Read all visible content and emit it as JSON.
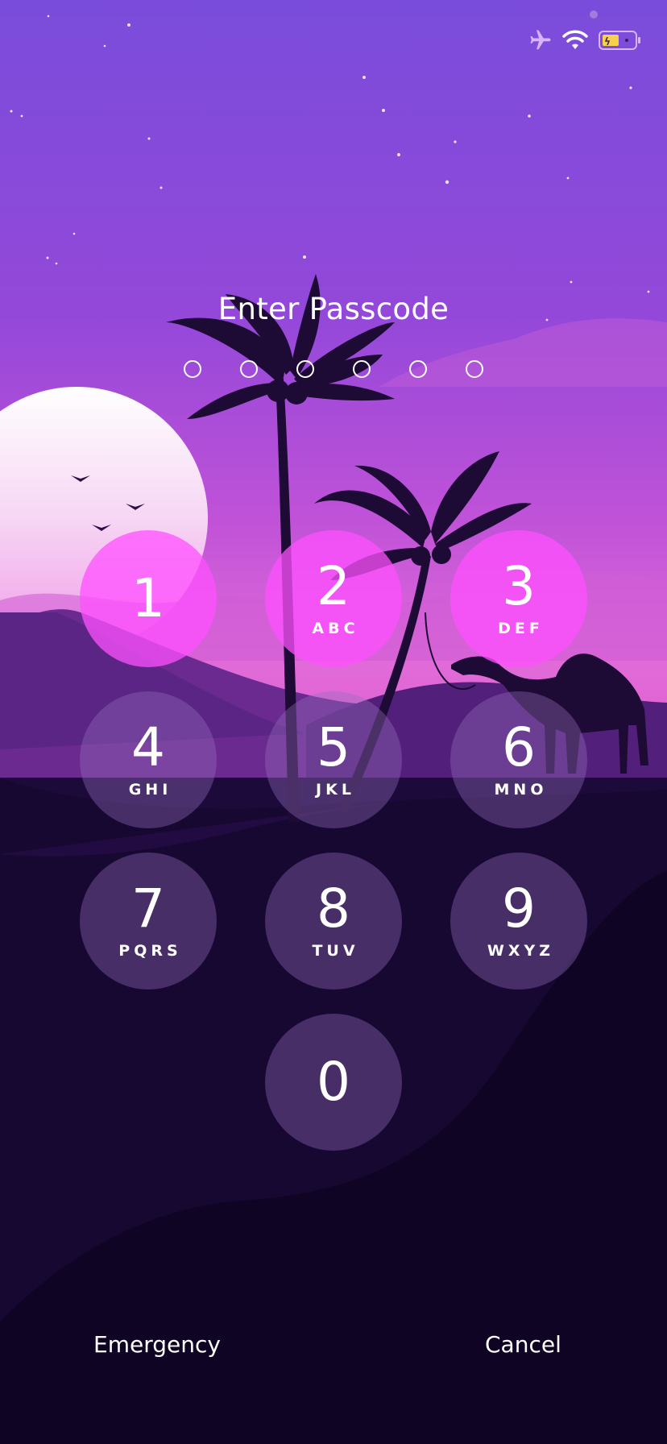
{
  "status_bar": {
    "icons": [
      "airplane-mode-icon",
      "wifi-icon",
      "battery-low-power-icon"
    ],
    "colors": {
      "icon": "#d9b3ff",
      "battery_fill": "#f6d24a"
    }
  },
  "lock_screen": {
    "title": "Enter Passcode",
    "passcode_length": 6,
    "filled_digits": 0
  },
  "keypad": [
    {
      "number": "1",
      "letters": ""
    },
    {
      "number": "2",
      "letters": "ABC"
    },
    {
      "number": "3",
      "letters": "DEF"
    },
    {
      "number": "4",
      "letters": "GHI"
    },
    {
      "number": "5",
      "letters": "JKL"
    },
    {
      "number": "6",
      "letters": "MNO"
    },
    {
      "number": "7",
      "letters": "PQRS"
    },
    {
      "number": "8",
      "letters": "TUV"
    },
    {
      "number": "9",
      "letters": "WXYZ"
    },
    {
      "number": "0",
      "letters": ""
    }
  ],
  "footer": {
    "emergency_label": "Emergency",
    "cancel_label": "Cancel"
  },
  "wallpaper": {
    "subject": "desert-sunset-palms-camel",
    "colors": {
      "sky_top": "#7a4cdb",
      "sky_bottom": "#e462d6",
      "ground": "#120628",
      "sun": "#ffffff"
    }
  }
}
